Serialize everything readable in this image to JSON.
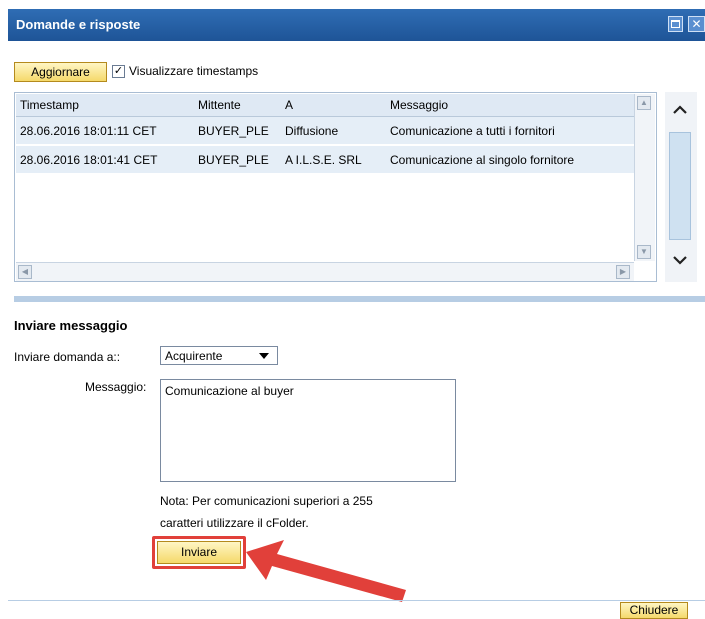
{
  "window": {
    "title": "Domande e risposte"
  },
  "toolbar": {
    "refresh_label": "Aggiornare",
    "show_timestamps_label": "Visualizzare timestamps",
    "show_timestamps_checked": true,
    "checkmark": "✓"
  },
  "table": {
    "columns": [
      "Timestamp",
      "Mittente",
      "A",
      "Messaggio"
    ],
    "rows": [
      [
        "28.06.2016 18:01:11 CET",
        "BUYER_PLE",
        "Diffusione",
        "Comunicazione a tutti i fornitori"
      ],
      [
        "28.06.2016 18:01:41 CET",
        "BUYER_PLE",
        "A I.L.S.E. SRL",
        "Comunicazione al singolo fornitore"
      ]
    ],
    "scroll_up": "▲",
    "scroll_down": "▼",
    "scroll_left": "◀",
    "scroll_right": "▶"
  },
  "external_scroll": {
    "up": "ˆ",
    "down": "ˇ"
  },
  "compose": {
    "section_title": "Inviare messaggio",
    "recipient_label": "Inviare domanda a::",
    "recipient_value": "Acquirente",
    "message_label": "Messaggio:",
    "message_value": "Comunicazione al buyer",
    "note_line1": "Nota: Per comunicazioni superiori a 255",
    "note_line2": "caratteri utilizzare il cFolder.",
    "send_label": "Inviare"
  },
  "footer": {
    "close_label": "Chiudere"
  },
  "colors": {
    "titlebar": "#2f6db4",
    "button": "#f5d96b",
    "highlight": "#e1403a",
    "arrow": "#e1403a",
    "row_bg": "#e5eef7"
  }
}
